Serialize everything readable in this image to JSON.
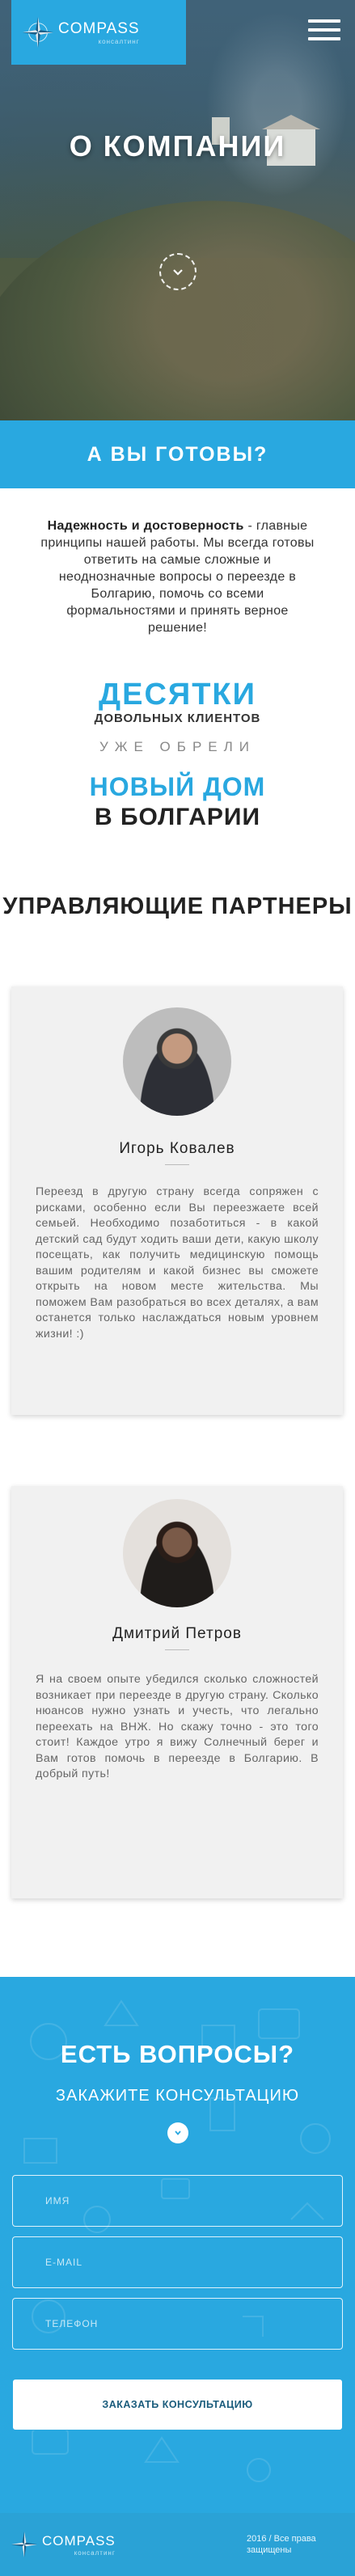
{
  "brand": {
    "name": "COMPASS",
    "tagline": "консалтинг",
    "accent_color": "#29a8e0"
  },
  "hero": {
    "title": "О КОМПАНИИ",
    "scroll_icon": "chevron-down-icon"
  },
  "band": {
    "title": "А ВЫ ГОТОВЫ?"
  },
  "about": {
    "lead": "Надежность и достоверность",
    "text": " - главные принципы нашей работы. Мы всегда готовы ответить на самые сложные и неоднозначные вопросы о переезде в Болгарию, помочь со всеми формальностями и принять верное решение!"
  },
  "stats": {
    "count_title": "ДЕСЯТКИ",
    "count_sub": "ДОВОЛЬНЫХ КЛИЕНТОВ",
    "middle": "УЖЕ ОБРЕЛИ",
    "result_title": "НОВЫЙ ДОМ",
    "result_sub": "В БОЛГАРИИ"
  },
  "partners": {
    "title": "УПРАВЛЯЮЩИЕ ПАРТНЕРЫ",
    "items": [
      {
        "name": "Игорь Ковалев",
        "bio": "Переезд в другую страну всегда сопряжен с рисками, особенно если Вы переезжаете всей семьей. Необходимо позаботиться - в какой детский сад будут ходить ваши дети, какую школу посещать, как получить медицинскую помощь вашим родителям и какой бизнес вы сможете открыть на новом месте жительства. Мы поможем Вам разобраться во всех деталях, а вам останется только наслаждаться новым уровнем жизни! :)"
      },
      {
        "name": "Дмитрий Петров",
        "bio": "Я на своем опыте убедился сколько сложностей возникает при переезде в другую страну. Сколько нюансов нужно узнать и учесть, что легально переехать на ВНЖ. Но скажу точно - это того стоит! Каждое утро я вижу Солнечный берег и Вам готов помочь в переезде в Болгарию. В добрый путь!"
      }
    ]
  },
  "contact": {
    "title": "ЕСТЬ ВОПРОСЫ?",
    "subtitle": "ЗАКАЖИТЕ КОНСУЛЬТАЦИЮ",
    "name_placeholder": "ИМЯ",
    "email_placeholder": "E-MAIL",
    "phone_placeholder": "ТЕЛЕФОН",
    "submit_label": "ЗАКАЗАТЬ КОНСУЛЬТАЦИЮ"
  },
  "footer": {
    "copyright": "2016 / Все права защищены"
  }
}
